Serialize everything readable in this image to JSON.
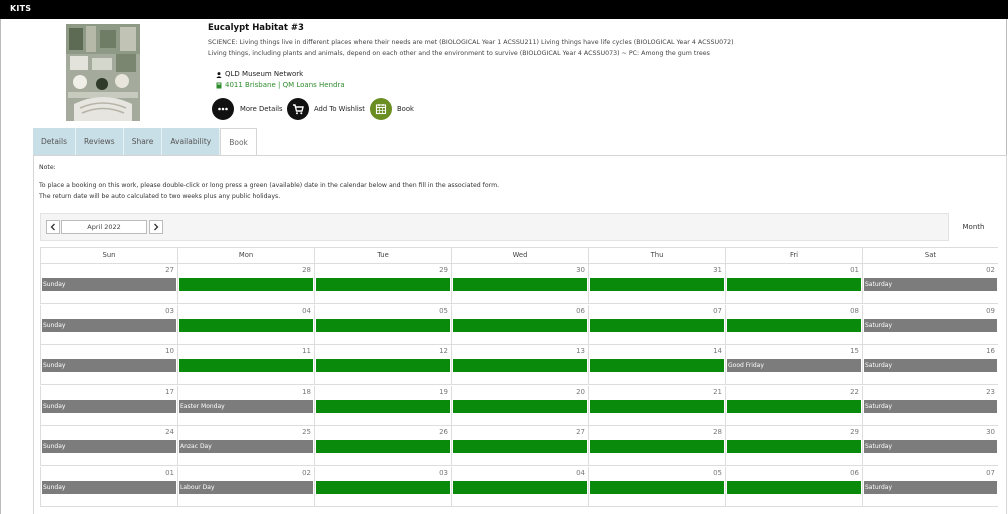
{
  "topbar": {
    "title": "KITS"
  },
  "item": {
    "title": "Eucalypt Habitat #3",
    "description_lines": [
      "SCIENCE: Living things live in different places where their needs are met (BIOLOGICAL Year 1 ACSSU211) Living things have life cycles (BIOLOGICAL Year 4 ACSSU072)",
      "Living things, including plants and animals, depend on each other and the environment to survive (BIOLOGICAL Year 4 ACSSU073) ~ PC: Among the gum trees"
    ],
    "provider": "QLD Museum Network",
    "location": "4011 Brisbane | QM Loans Hendra"
  },
  "actions": {
    "more_details": "More Details",
    "wishlist": "Add To Wishlist",
    "book": "Book"
  },
  "tabs": [
    "Details",
    "Reviews",
    "Share",
    "Availability",
    "Book"
  ],
  "active_tab": "Book",
  "booking": {
    "note": "Note:",
    "instructions": [
      "To place a booking on this work, please double-click or long press a green (available) date in the calendar below and then fill in the associated form.",
      "The return date will be auto calculated to two weeks plus any public holidays."
    ]
  },
  "calendar": {
    "month_label": "April 2022",
    "view_label": "Month",
    "weekdays": [
      "Sun",
      "Mon",
      "Tue",
      "Wed",
      "Thu",
      "Fri",
      "Sat"
    ],
    "colors": {
      "available": "#0a8a0a",
      "unavailable": "#7c7c7c"
    },
    "weeks": [
      [
        {
          "d": "27",
          "s": "u",
          "t": "Sunday"
        },
        {
          "d": "28",
          "s": "a",
          "t": ""
        },
        {
          "d": "29",
          "s": "a",
          "t": ""
        },
        {
          "d": "30",
          "s": "a",
          "t": ""
        },
        {
          "d": "31",
          "s": "a",
          "t": ""
        },
        {
          "d": "01",
          "s": "a",
          "t": ""
        },
        {
          "d": "02",
          "s": "u",
          "t": "Saturday"
        }
      ],
      [
        {
          "d": "03",
          "s": "u",
          "t": "Sunday"
        },
        {
          "d": "04",
          "s": "a",
          "t": ""
        },
        {
          "d": "05",
          "s": "a",
          "t": ""
        },
        {
          "d": "06",
          "s": "a",
          "t": ""
        },
        {
          "d": "07",
          "s": "a",
          "t": ""
        },
        {
          "d": "08",
          "s": "a",
          "t": ""
        },
        {
          "d": "09",
          "s": "u",
          "t": "Saturday"
        }
      ],
      [
        {
          "d": "10",
          "s": "u",
          "t": "Sunday"
        },
        {
          "d": "11",
          "s": "a",
          "t": ""
        },
        {
          "d": "12",
          "s": "a",
          "t": ""
        },
        {
          "d": "13",
          "s": "a",
          "t": ""
        },
        {
          "d": "14",
          "s": "a",
          "t": ""
        },
        {
          "d": "15",
          "s": "u",
          "t": "Good Friday"
        },
        {
          "d": "16",
          "s": "u",
          "t": "Saturday"
        }
      ],
      [
        {
          "d": "17",
          "s": "u",
          "t": "Sunday"
        },
        {
          "d": "18",
          "s": "u",
          "t": "Easter Monday"
        },
        {
          "d": "19",
          "s": "a",
          "t": ""
        },
        {
          "d": "20",
          "s": "a",
          "t": ""
        },
        {
          "d": "21",
          "s": "a",
          "t": ""
        },
        {
          "d": "22",
          "s": "a",
          "t": ""
        },
        {
          "d": "23",
          "s": "u",
          "t": "Saturday"
        }
      ],
      [
        {
          "d": "24",
          "s": "u",
          "t": "Sunday"
        },
        {
          "d": "25",
          "s": "u",
          "t": "Anzac Day"
        },
        {
          "d": "26",
          "s": "a",
          "t": ""
        },
        {
          "d": "27",
          "s": "a",
          "t": ""
        },
        {
          "d": "28",
          "s": "a",
          "t": ""
        },
        {
          "d": "29",
          "s": "a",
          "t": ""
        },
        {
          "d": "30",
          "s": "u",
          "t": "Saturday"
        }
      ],
      [
        {
          "d": "01",
          "s": "u",
          "t": "Sunday"
        },
        {
          "d": "02",
          "s": "u",
          "t": "Labour Day"
        },
        {
          "d": "03",
          "s": "a",
          "t": ""
        },
        {
          "d": "04",
          "s": "a",
          "t": ""
        },
        {
          "d": "05",
          "s": "a",
          "t": ""
        },
        {
          "d": "06",
          "s": "a",
          "t": ""
        },
        {
          "d": "07",
          "s": "u",
          "t": "Saturday"
        }
      ]
    ]
  }
}
